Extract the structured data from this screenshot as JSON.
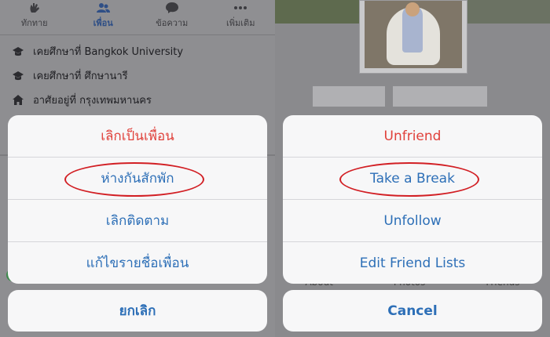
{
  "left": {
    "tabs": [
      {
        "label": "ทักทาย",
        "icon": "wave-hand-icon"
      },
      {
        "label": "เพื่อน",
        "icon": "friends-icon",
        "active": true
      },
      {
        "label": "ข้อความ",
        "icon": "messenger-icon"
      },
      {
        "label": "เพิ่มเติม",
        "icon": "more-icon"
      }
    ],
    "info": [
      {
        "text": "เคยศึกษาที่ Bangkok University",
        "icon": "graduation-cap-icon"
      },
      {
        "text": "เคยศึกษาที่ ศึกษานารี",
        "icon": "graduation-cap-icon"
      },
      {
        "text": "อาศัยอยู่ที่ กรุงเทพมหานคร",
        "icon": "home-icon"
      }
    ],
    "actions": [
      {
        "label": "เลิกเป็นเพื่อน",
        "style": "destructive"
      },
      {
        "label": "ห่างกันสักพัก",
        "highlighted": true
      },
      {
        "label": "เลิกติดตาม"
      },
      {
        "label": "แก้ไขรายชื่อเพื่อน"
      }
    ],
    "cancel": "ยกเลิก"
  },
  "right": {
    "actions": [
      {
        "label": "Unfriend",
        "style": "destructive"
      },
      {
        "label": "Take a Break",
        "highlighted": true
      },
      {
        "label": "Unfollow"
      },
      {
        "label": "Edit Friend Lists"
      }
    ],
    "cancel": "Cancel",
    "ghost_tabs": [
      "About",
      "Photos",
      "Friends"
    ]
  },
  "colors": {
    "action_blue": "#2d6fb7",
    "destructive_red": "#e0413b",
    "highlight_ring": "#d21f24",
    "sheet_bg": "#f7f7f8"
  }
}
